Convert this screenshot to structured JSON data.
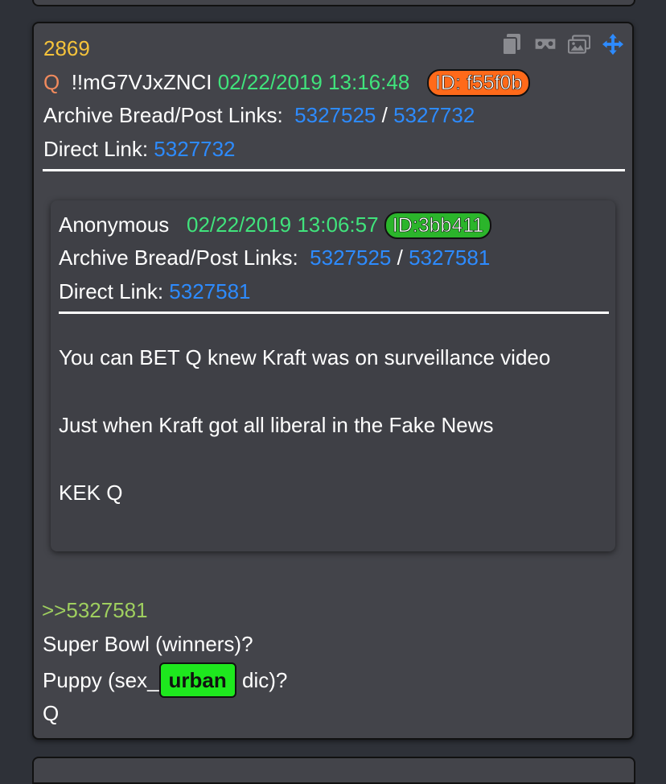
{
  "post": {
    "number": "2869",
    "author": "Q",
    "tripcode": "!!mG7VJxZNCI",
    "date": "02/22/2019 13:16:48",
    "id_badge": "ID: f55f0b",
    "archive_label": "Archive Bread/Post Links:",
    "archive_link_1": "5327525",
    "archive_sep": "/",
    "archive_link_2": "5327732",
    "direct_label": "Direct Link:",
    "direct_link": "5327732",
    "toolbar_icons": [
      "copy-icon",
      "vr-goggles-icon",
      "images-icon",
      "move-icon"
    ],
    "colors": {
      "post_number": "#f5c33b",
      "date": "#40e37c",
      "link": "#2d8bff",
      "id_badge_q": "#ff6a1a",
      "id_badge_anon": "#2bb52b",
      "urban_tag": "#1ee81e"
    }
  },
  "quoted": {
    "author": "Anonymous",
    "date": "02/22/2019 13:06:57",
    "id_badge": "ID:3bb411",
    "archive_label": "Archive Bread/Post Links:",
    "archive_link_1": "5327525",
    "archive_sep": "/",
    "archive_link_2": "5327581",
    "direct_label": "Direct Link:",
    "direct_link": "5327581",
    "body": [
      "You can BET Q knew Kraft was on surveillance video",
      "Just when Kraft got all liberal in the Fake News",
      "KEK Q"
    ]
  },
  "reply": {
    "quote_ref": ">>5327581",
    "line1": "Super Bowl (winners)?",
    "line2_prefix": "Puppy (sex_",
    "urban_tag": "urban",
    "line2_suffix": " dic)?",
    "signature": "Q"
  }
}
